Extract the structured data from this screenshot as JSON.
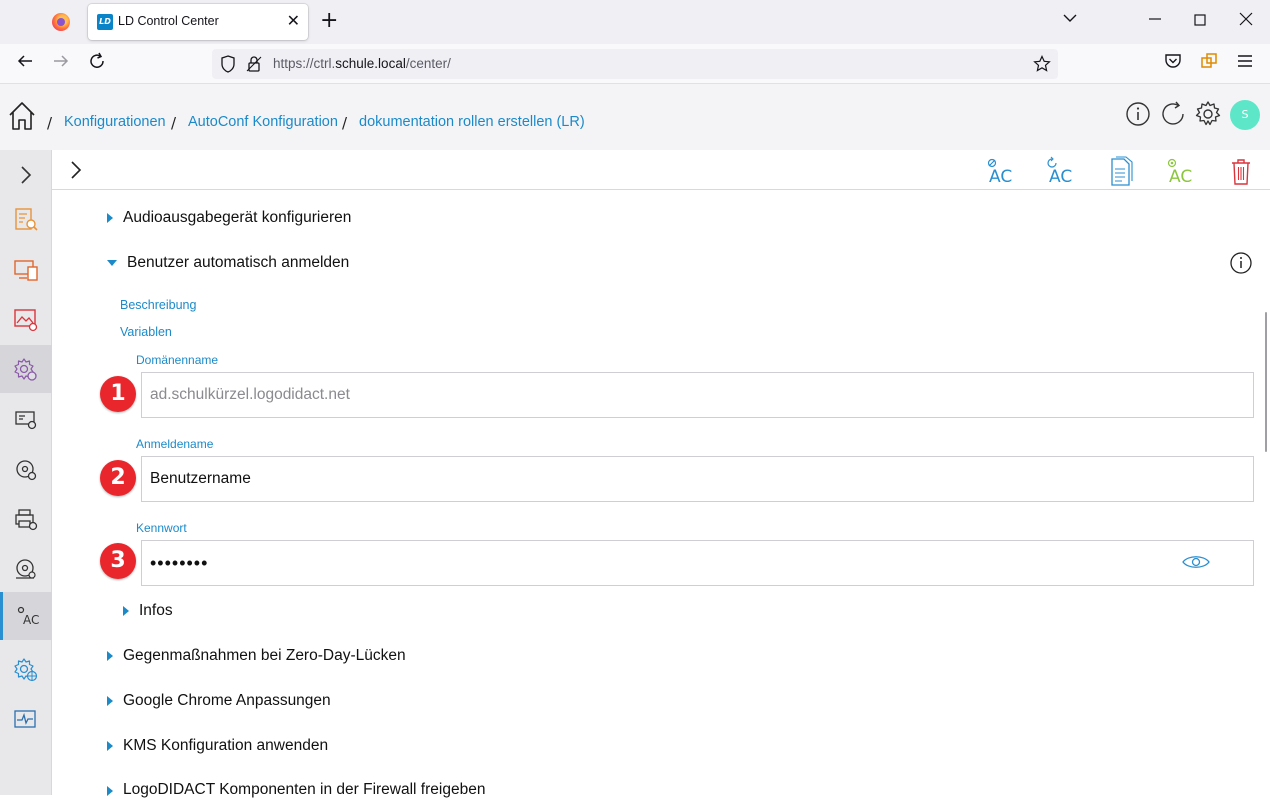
{
  "browser": {
    "tab_title": "LD Control Center",
    "favicon_text": "LD",
    "url_prefix": "https://ctrl.",
    "url_host": "schule.local",
    "url_path": "/center/"
  },
  "header": {
    "breadcrumb": [
      "Konfigurationen",
      "AutoConf Konfiguration",
      "dokumentation rollen erstellen (LR)"
    ],
    "avatar_initial": "S"
  },
  "toolbar": {
    "icons": [
      "ac-edit-icon",
      "ac-refresh-icon",
      "document-icon",
      "ac-add-icon",
      "trash-icon"
    ],
    "icon_labels": [
      "AC",
      "AC",
      "AC"
    ]
  },
  "sections": {
    "audio": "Audioausgabegerät konfigurieren",
    "autologin": "Benutzer automatisch anmelden",
    "beschreibung": "Beschreibung",
    "variablen": "Variablen",
    "infos": "Infos",
    "zeroday": "Gegenmaßnahmen bei Zero-Day-Lücken",
    "chrome": "Google Chrome Anpassungen",
    "kms": "KMS Konfiguration anwenden",
    "logodidact": "LogoDIDACT Komponenten in der Firewall freigeben"
  },
  "fields": {
    "domain_label": "Domänenname",
    "domain_placeholder": "ad.schulkürzel.logodidact.net",
    "login_label": "Anmeldename",
    "login_value": "Benutzername",
    "password_label": "Kennwort",
    "password_value": "••••••••"
  },
  "badges": [
    "1",
    "2",
    "3"
  ],
  "colors": {
    "accent": "#1c8ac9",
    "badge": "#e8262b",
    "avatar": "#5ee6c8"
  }
}
